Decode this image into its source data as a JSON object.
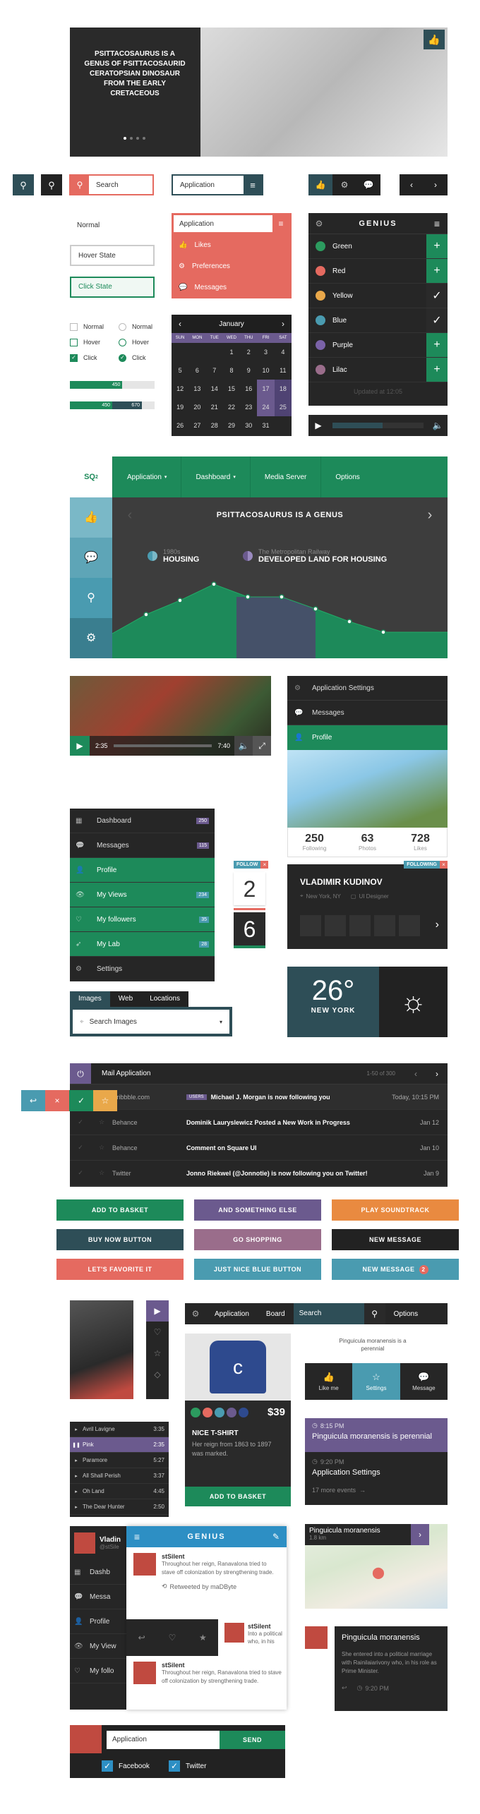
{
  "hero": {
    "title": "PSITTACOSAURUS IS A GENUS OF PSITTACOSAURID CERATOPSIAN DINOSAUR FROM THE EARLY CRETACEOUS"
  },
  "search": {
    "label": "Search",
    "value": "Application"
  },
  "inputs": {
    "normal": "Normal",
    "hover": "Hover State",
    "click": "Click State"
  },
  "dropdown": {
    "title": "Application",
    "items": [
      "Likes",
      "Preferences",
      "Messages"
    ]
  },
  "genius": {
    "title": "GENIUS",
    "items": [
      {
        "label": "Green",
        "color": "#2c9b5f",
        "action": "+"
      },
      {
        "label": "Red",
        "color": "#e56a60",
        "action": "+"
      },
      {
        "label": "Yellow",
        "color": "#e9a84a",
        "action": "✓"
      },
      {
        "label": "Blue",
        "color": "#4a9bb0",
        "action": "✓"
      },
      {
        "label": "Purple",
        "color": "#7a62a8",
        "action": "+"
      },
      {
        "label": "Lilac",
        "color": "#9a6d8b",
        "action": "+"
      }
    ],
    "footer": "Updated at 12:05"
  },
  "checks": {
    "normal": "Normal",
    "hover": "Hover",
    "click": "Click"
  },
  "bars": {
    "a": "450",
    "b": "450",
    "c": "670",
    "a_pct": 0.62,
    "b_pct": 0.5,
    "c_pct": 0.85
  },
  "calendar": {
    "month": "January",
    "days": [
      "SUN",
      "MON",
      "TUE",
      "WED",
      "THU",
      "FRI",
      "SAT"
    ],
    "weeks": [
      [
        "",
        "",
        "",
        "1",
        "2",
        "3",
        "4"
      ],
      [
        "5",
        "6",
        "7",
        "8",
        "9",
        "10",
        "11"
      ],
      [
        "12",
        "13",
        "14",
        "15",
        "16",
        "17",
        "18"
      ],
      [
        "19",
        "20",
        "21",
        "22",
        "23",
        "24",
        "25"
      ],
      [
        "26",
        "27",
        "28",
        "29",
        "30",
        "31",
        ""
      ]
    ]
  },
  "app_nav": {
    "logo": "SQ",
    "logo_sup": "2",
    "tabs": [
      "Application",
      "Dashboard",
      "Media Server",
      "Options"
    ],
    "banner_title": "PSITTACOSAURUS IS A GENUS",
    "left_label_small": "1980s",
    "left_label": "HOUSING",
    "right_label_small": "The Metropolitan Railway",
    "right_label": "DEVELOPED LAND FOR HOUSING"
  },
  "video": {
    "time_current": "2:35",
    "time_total": "7:40"
  },
  "settings_menu": {
    "items": [
      "Application Settings",
      "Messages",
      "Profile"
    ]
  },
  "profile_stats": {
    "following": "250",
    "following_label": "Following",
    "photos": "63",
    "photos_label": "Photos",
    "likes": "728",
    "likes_label": "Likes"
  },
  "side_menu": {
    "items": [
      {
        "label": "Dashboard",
        "badge": "250"
      },
      {
        "label": "Messages",
        "badge": "115"
      },
      {
        "label": "Profile",
        "badge": ""
      },
      {
        "label": "My Views",
        "badge": "234"
      },
      {
        "label": "My followers",
        "badge": "35"
      },
      {
        "label": "My Lab",
        "badge": "28"
      },
      {
        "label": "Settings",
        "badge": ""
      }
    ]
  },
  "follow": {
    "label": "FOLLOW",
    "n1": "2",
    "n2": "6"
  },
  "profile_card": {
    "following": "FOLLOWING",
    "name": "VLADIMIR KUDINOV",
    "location": "New York, NY",
    "role": "UI Designer"
  },
  "tabs_search": {
    "tabs": [
      "Images",
      "Web",
      "Locations"
    ],
    "placeholder": "Search Images"
  },
  "weather": {
    "temp": "26°",
    "city": "NEW YORK"
  },
  "mail": {
    "title": "Mail Application",
    "count": "1-50 of 300",
    "rows": [
      {
        "from": "Dribbble.com",
        "tag": "USERS",
        "subject": "Michael J. Morgan is now following you",
        "date": "Today, 10:15 PM"
      },
      {
        "from": "Behance",
        "tag": "",
        "subject": "Dominik Lauryslewicz Posted a New Work in Progress",
        "date": "Jan 12"
      },
      {
        "from": "Behance",
        "tag": "",
        "subject": "Comment on Square UI",
        "date": "Jan 10"
      },
      {
        "from": "Twitter",
        "tag": "",
        "subject": "Jonno Riekwel (@Jonnotie) is now following you on Twitter!",
        "date": "Jan 9"
      }
    ]
  },
  "buttons": {
    "b1": "ADD TO BASKET",
    "b2": "AND SOMETHING ELSE",
    "b3": "PLAY SOUNDTRACK",
    "b4": "BUY NOW BUTTON",
    "b5": "GO SHOPPING",
    "b6": "NEW MESSAGE",
    "b7": "LET'S FAVORITE IT",
    "b8": "JUST NICE BLUE BUTTON",
    "b9": "NEW MESSAGE",
    "b9_badge": "2"
  },
  "nav2": {
    "items": [
      "Application",
      "Board",
      "Search",
      "Options"
    ]
  },
  "tooltip": {
    "text": "Pinguicula moranensis is a perennial"
  },
  "shirt": {
    "price": "$39",
    "name": "NICE T-SHIRT",
    "desc": "Her reign from 1863 to 1897 was marked.",
    "cta": "ADD TO BASKET"
  },
  "action_bar": {
    "items": [
      "Like me",
      "Settings",
      "Message"
    ]
  },
  "timeline": {
    "t1": "8:15 PM",
    "title1": "Pinguicula moranensis is perennial",
    "t2": "9:20 PM",
    "title2": "Application Settings",
    "footer": "17 more events"
  },
  "playlist": {
    "items": [
      {
        "name": "Avril Lavigne",
        "time": "3:35"
      },
      {
        "name": "Pink",
        "time": "2:35"
      },
      {
        "name": "Paramore",
        "time": "5:27"
      },
      {
        "name": "All Shall Perish",
        "time": "3:37"
      },
      {
        "name": "Oh Land",
        "time": "4:45"
      },
      {
        "name": "The Dear Hunter",
        "time": "2:50"
      }
    ]
  },
  "feed": {
    "title": "GENIUS",
    "user": "stSilent",
    "post": "Throughout her reign, Ranavalona tried to stave off colonization by strengthening trade.",
    "retweet": "Retweeted by maDByte",
    "post2": "Throughout her reign, Ranavalona tried to stave off colonization by strengthening trade.",
    "side_user": "stSilent",
    "side_text": "Into a political who, in his",
    "menu_under": [
      "Dashb",
      "Messa",
      "Profile",
      "My View",
      "My follo"
    ],
    "under_name": "Vladin",
    "under_handle": "@stSile"
  },
  "map": {
    "title": "Pinguicula moranensis",
    "dist": "1.8 km"
  },
  "note": {
    "title": "Pinguicula moranensis",
    "text": "She entered into a political marriage with Rainilaiarivony who, in his role as Prime Minister.",
    "time": "9:20 PM"
  },
  "composer": {
    "value": "Application",
    "send": "SEND",
    "fb": "Facebook",
    "tw": "Twitter"
  }
}
